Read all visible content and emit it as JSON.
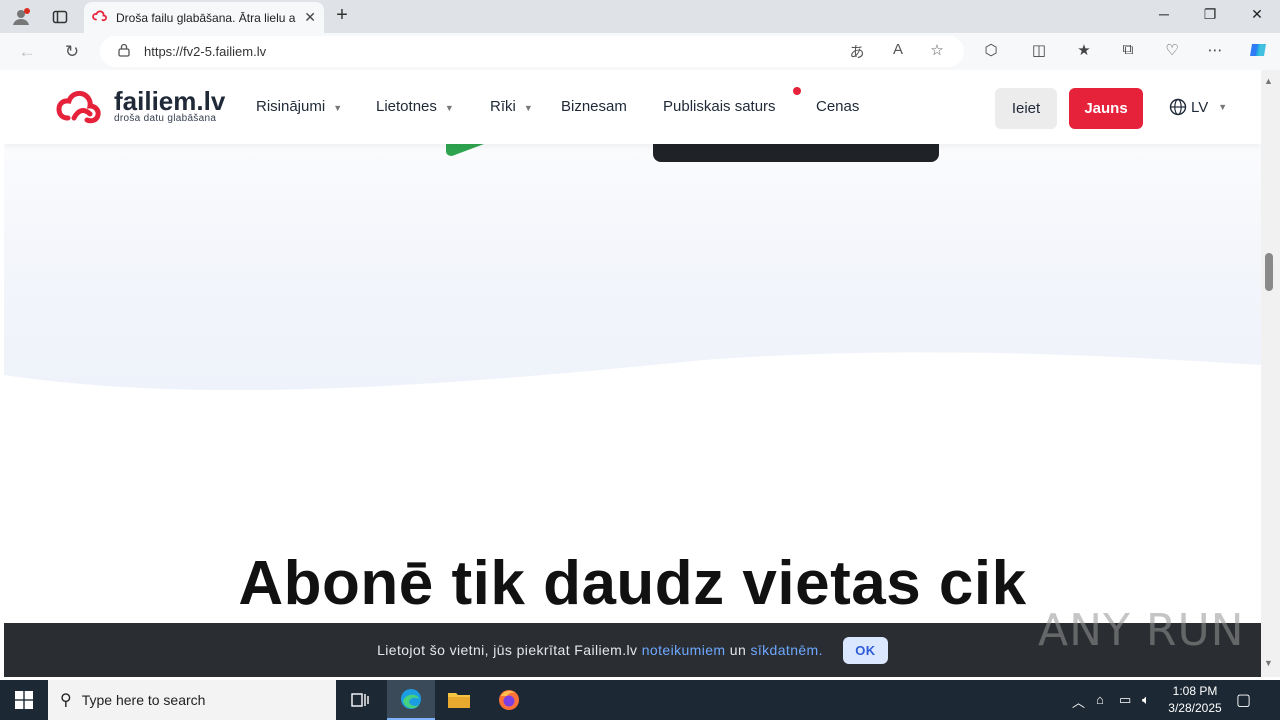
{
  "browser": {
    "tab_title": "Droša failu glabāšana. Ātra lielu a",
    "url": "https://fv2-5.failiem.lv",
    "new_tab_symbol": "+",
    "window_controls": [
      "─",
      "❐",
      "✕"
    ]
  },
  "site": {
    "logo_name": "failiem.lv",
    "logo_tagline": "droša datu glabāšana",
    "nav": [
      {
        "label": "Risinājumi",
        "dropdown": true
      },
      {
        "label": "Lietotnes",
        "dropdown": true
      },
      {
        "label": "Rīki",
        "dropdown": true
      },
      {
        "label": "Biznesam",
        "dropdown": false
      },
      {
        "label": "Publiskais saturs",
        "dropdown": false
      },
      {
        "label": "Cenas",
        "dropdown": false
      }
    ],
    "login_label": "Ieiet",
    "signup_label": "Jauns",
    "language": "LV",
    "brand_color": "#e5223a",
    "headline": "Abonē tik daudz vietas cik"
  },
  "cookie_banner": {
    "text_before": "Lietojot šo vietni, jūs piekrītat Failiem.lv ",
    "terms_link": "noteikumiem",
    "text_middle": " un ",
    "cookies_link": "sīkdatnēm.",
    "ok_label": "OK"
  },
  "watermark": "ANY RUN",
  "taskbar": {
    "search_placeholder": "Type here to search",
    "time": "1:08 PM",
    "date": "3/28/2025"
  }
}
